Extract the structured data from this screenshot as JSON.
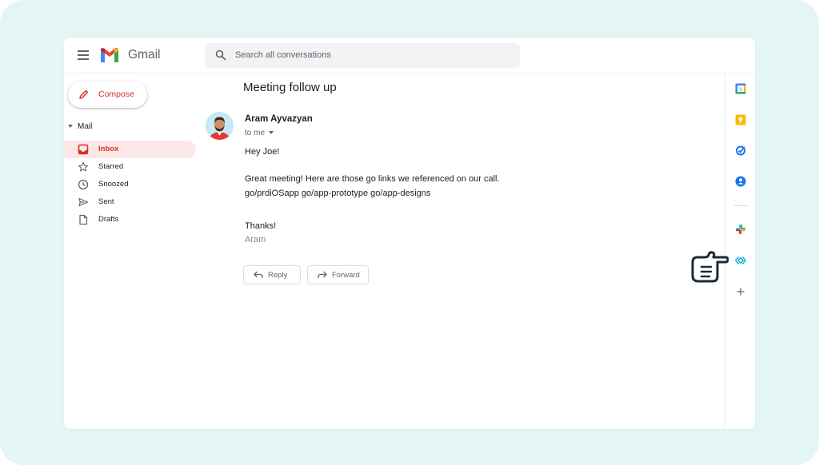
{
  "app": {
    "brand": "Gmail",
    "accent_color": "#d93025"
  },
  "header": {
    "menu_icon": "hamburger-menu-icon",
    "search": {
      "placeholder": "Search all conversations",
      "value": ""
    }
  },
  "sidebar": {
    "compose_label": "Compose",
    "section_label": "Mail",
    "items": [
      {
        "label": "Inbox",
        "icon": "inbox-icon",
        "active": true
      },
      {
        "label": "Starred",
        "icon": "star-icon",
        "active": false
      },
      {
        "label": "Snoozed",
        "icon": "clock-icon",
        "active": false
      },
      {
        "label": "Sent",
        "icon": "send-icon",
        "active": false
      },
      {
        "label": "Drafts",
        "icon": "draft-icon",
        "active": false
      }
    ]
  },
  "message": {
    "subject": "Meeting follow up",
    "sender": "Aram Ayvazyan",
    "recipient": "to me",
    "body": [
      "Hey Joe!",
      "Great meeting! Here are those go links we referenced on our call.",
      "go/prdiOSapp go/app-prototype go/app-designs",
      "Thanks!"
    ],
    "signature": "Aram",
    "reply_label": "Reply",
    "forward_label": "Forward"
  },
  "rail": {
    "icons": [
      "calendar-icon",
      "keep-icon",
      "tasks-icon",
      "contacts-icon",
      "slack-icon",
      "golinks-icon",
      "add-icon"
    ]
  }
}
